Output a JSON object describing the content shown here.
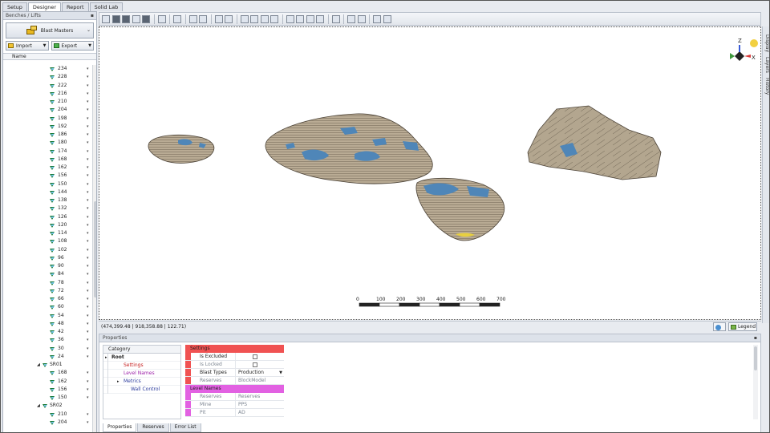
{
  "top_tabs": [
    "Setup",
    "Designer",
    "Report",
    "Solid Lab"
  ],
  "active_top_tab": "Designer",
  "left_panel": {
    "title": "Benches / Lifts",
    "pin_icon": "pin-icon",
    "blast_button": "Blast Masters",
    "import_label": "Import",
    "export_label": "Export",
    "column_header": "Name",
    "tree": [
      {
        "label": "234",
        "type": "item"
      },
      {
        "label": "228",
        "type": "item"
      },
      {
        "label": "222",
        "type": "item"
      },
      {
        "label": "216",
        "type": "item"
      },
      {
        "label": "210",
        "type": "item"
      },
      {
        "label": "204",
        "type": "item"
      },
      {
        "label": "198",
        "type": "item"
      },
      {
        "label": "192",
        "type": "item"
      },
      {
        "label": "186",
        "type": "item"
      },
      {
        "label": "180",
        "type": "item"
      },
      {
        "label": "174",
        "type": "item"
      },
      {
        "label": "168",
        "type": "item"
      },
      {
        "label": "162",
        "type": "item"
      },
      {
        "label": "156",
        "type": "item"
      },
      {
        "label": "150",
        "type": "item"
      },
      {
        "label": "144",
        "type": "item"
      },
      {
        "label": "138",
        "type": "item"
      },
      {
        "label": "132",
        "type": "item"
      },
      {
        "label": "126",
        "type": "item"
      },
      {
        "label": "120",
        "type": "item"
      },
      {
        "label": "114",
        "type": "item"
      },
      {
        "label": "108",
        "type": "item"
      },
      {
        "label": "102",
        "type": "item"
      },
      {
        "label": "96",
        "type": "item"
      },
      {
        "label": "90",
        "type": "item"
      },
      {
        "label": "84",
        "type": "item"
      },
      {
        "label": "78",
        "type": "item"
      },
      {
        "label": "72",
        "type": "item"
      },
      {
        "label": "66",
        "type": "item"
      },
      {
        "label": "60",
        "type": "item"
      },
      {
        "label": "54",
        "type": "item"
      },
      {
        "label": "48",
        "type": "item"
      },
      {
        "label": "42",
        "type": "item"
      },
      {
        "label": "36",
        "type": "item"
      },
      {
        "label": "30",
        "type": "item"
      },
      {
        "label": "24",
        "type": "item"
      },
      {
        "label": "SR01",
        "type": "group"
      },
      {
        "label": "168",
        "type": "item"
      },
      {
        "label": "162",
        "type": "item"
      },
      {
        "label": "156",
        "type": "item"
      },
      {
        "label": "150",
        "type": "item"
      },
      {
        "label": "SR02",
        "type": "group"
      },
      {
        "label": "210",
        "type": "item"
      },
      {
        "label": "204",
        "type": "item"
      }
    ]
  },
  "right_strip_tabs": [
    "Display",
    "Layers",
    "History"
  ],
  "viewport": {
    "scale_ticks": [
      "0",
      "100",
      "200",
      "300",
      "400",
      "500",
      "600",
      "700"
    ],
    "axis_labels": {
      "z": "Z",
      "x": "X"
    }
  },
  "status": {
    "coords": "(474,399.48 | 918,358.88 | 122.71)",
    "legend_label": "Legend"
  },
  "properties": {
    "title": "Properties",
    "category_header": "Category",
    "tree": [
      {
        "label": "Root",
        "level": 0
      },
      {
        "label": "Settings",
        "level": 1
      },
      {
        "label": "Level Names",
        "level": 1
      },
      {
        "label": "Metrics",
        "level": 1
      },
      {
        "label": "Wall Control",
        "level": 2
      }
    ],
    "settings_section": "Settings",
    "settings_rows": [
      {
        "key": "Is Excluded",
        "value": ""
      },
      {
        "key": "Is Locked",
        "value": ""
      },
      {
        "key": "Blast Types",
        "value": "Production"
      },
      {
        "key": "Reserves Source",
        "value": "BlockModel"
      }
    ],
    "levelnames_section": "Level Names",
    "levelnames_rows": [
      {
        "key": "Reserves",
        "value": "Reserves"
      },
      {
        "key": "Mine",
        "value": "PPS"
      },
      {
        "key": "Pit",
        "value": "AD"
      }
    ],
    "bottom_tabs": [
      "Properties",
      "Reserves",
      "Error List"
    ]
  },
  "colors": {
    "rock": "#b5a892",
    "ore": "#4f86b8",
    "settings_red": "#f05252",
    "levelnames_pink": "#e261e2"
  }
}
